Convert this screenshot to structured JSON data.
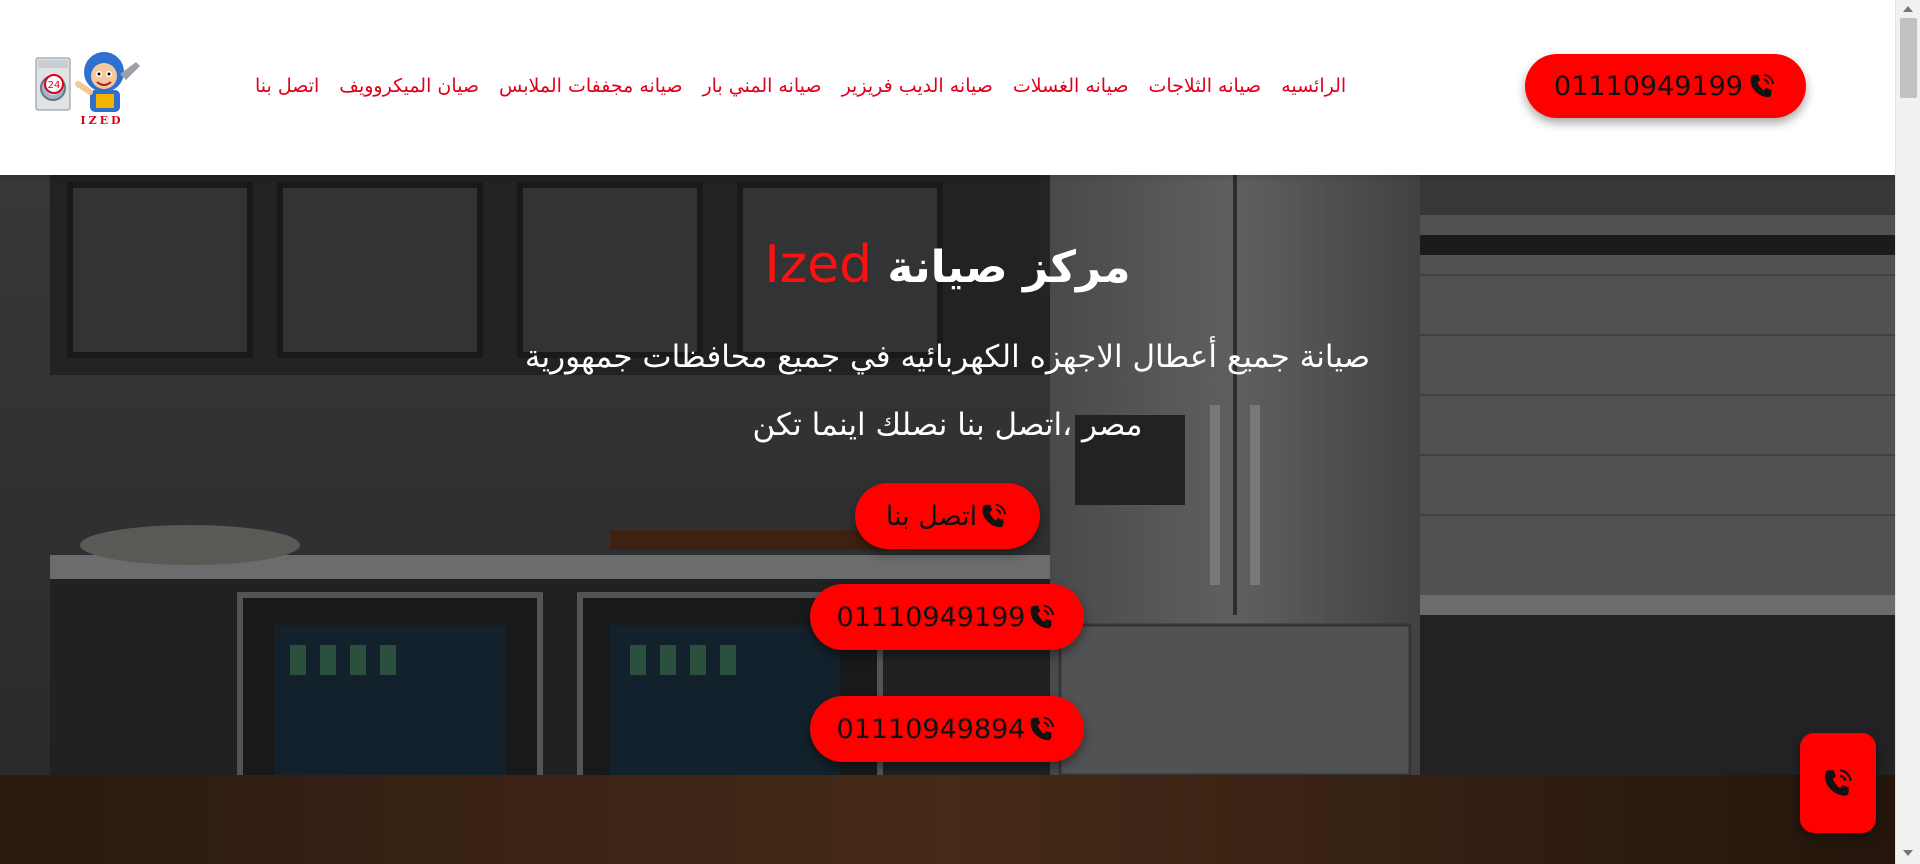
{
  "header": {
    "logo_text": "IZED",
    "logo_badge": "24",
    "nav": [
      {
        "label": "الرائسيه"
      },
      {
        "label": "صيانه الثلاجات"
      },
      {
        "label": "صيانه الغسلات"
      },
      {
        "label": "صيانه الديب فريزير"
      },
      {
        "label": "صيانه المني بار"
      },
      {
        "label": "صيانه مجففات الملابس"
      },
      {
        "label": "صيان الميكروويف"
      },
      {
        "label": "اتصل بنا"
      }
    ],
    "phone": "01110949199"
  },
  "hero": {
    "title_prefix": "مركز صيانة",
    "title_brand": "Ized",
    "description": "صيانة جميع أعطال الاجهزه الكهربائيه في جميع محافظات جمهورية مصر ،اتصل بنا نصلك اينما تكن",
    "cta_contact": "اتصل بنا",
    "cta_phone_1": "01110949199",
    "cta_phone_2": "01110949894"
  },
  "colors": {
    "accent": "#ff0000",
    "nav_text": "#e0001b",
    "header_bg": "#ffffff"
  },
  "icons": {
    "phone": "phone-ringing-icon",
    "float": "phone-ringing-icon"
  }
}
